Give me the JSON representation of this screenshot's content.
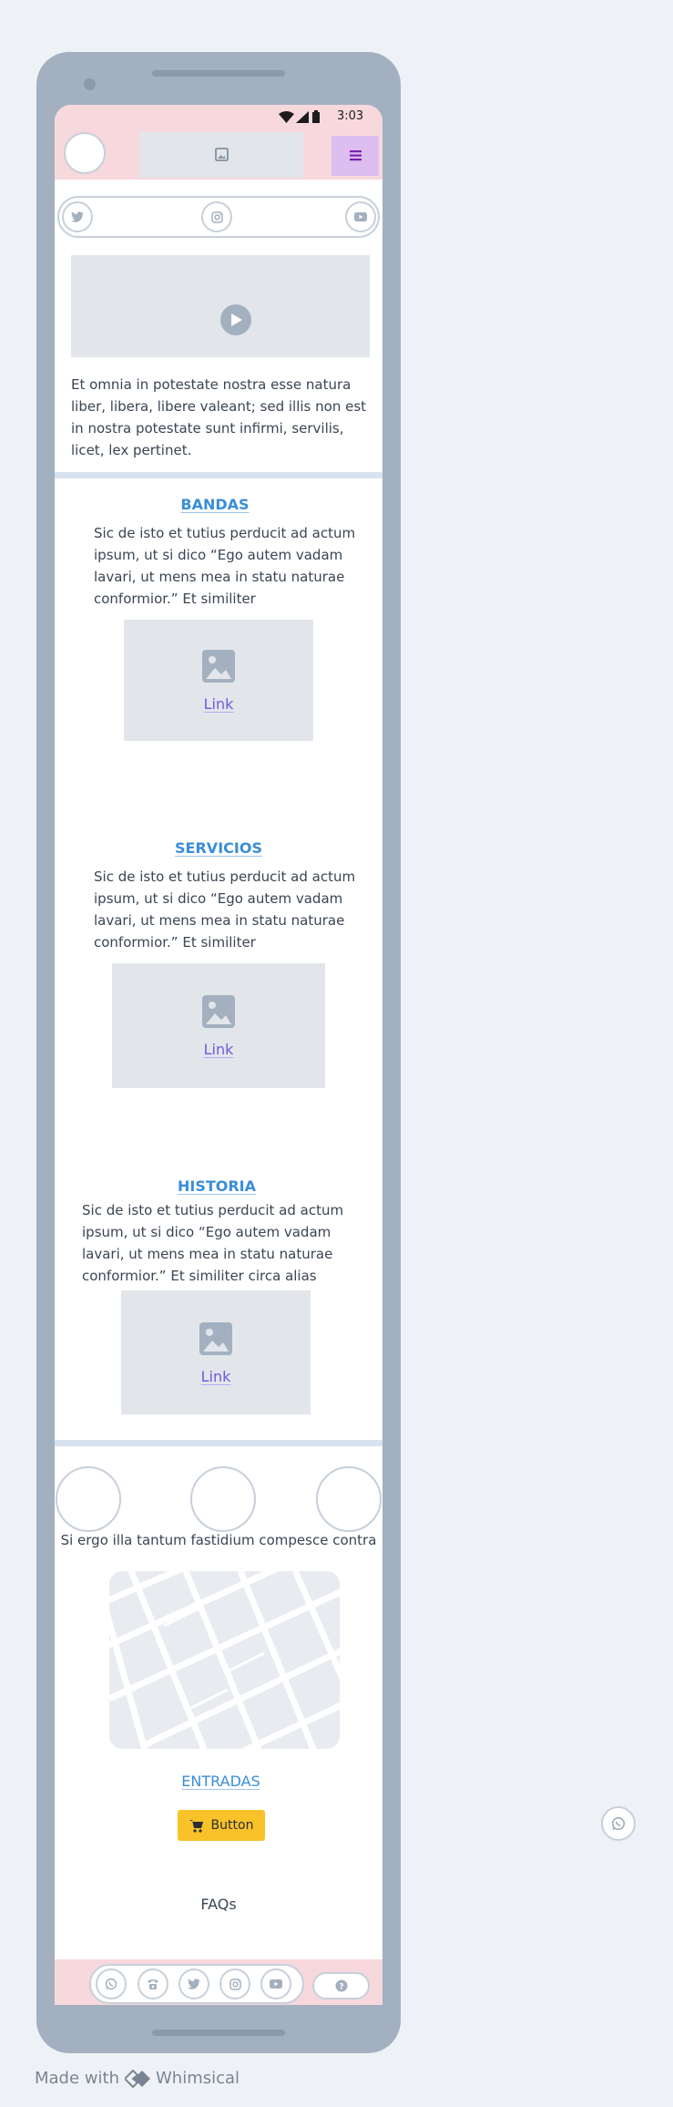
{
  "status_bar": {
    "time": "3:03"
  },
  "intro": {
    "text": "Et omnia in potestate nostra esse natura liber, libera, libere valeant; sed illis non est in nostra potestate sunt infirmi, servilis, licet, lex pertinet."
  },
  "sections": [
    {
      "title": "BANDAS",
      "text": "Sic de isto et tutius perducit ad actum ipsum, ut si dico “Ego autem vadam lavari, ut mens mea in statu naturae conformior.” Et similiter",
      "link": "Link"
    },
    {
      "title": "SERVICIOS",
      "text": "Sic de isto et tutius perducit ad actum ipsum, ut si dico “Ego autem vadam lavari, ut mens mea in statu naturae conformior.” Et similiter",
      "link": "Link"
    },
    {
      "title": "HISTORIA",
      "text": "Sic de isto et tutius perducit ad actum ipsum, ut si dico “Ego autem vadam lavari, ut mens mea in statu naturae conformior.” Et similiter circa alias",
      "link": "Link"
    }
  ],
  "partners": {
    "caption": "Si ergo illa tantum fastidium compesce contra"
  },
  "tickets": {
    "title": "ENTRADAS",
    "button_label": "Button"
  },
  "faqs": {
    "label": "FAQs"
  },
  "made_with": {
    "prefix": "Made with",
    "brand": "Whimsical"
  },
  "colors": {
    "header_bg": "#f7d8dd",
    "menu_bg": "#dcbef0",
    "accent_link": "#3a8ed8",
    "link": "#6f5ae0",
    "button": "#f9c228"
  },
  "icons": [
    "wifi-icon",
    "signal-icon",
    "battery-icon",
    "image-icon",
    "hamburger-icon",
    "twitter-icon",
    "instagram-icon",
    "youtube-icon",
    "play-icon",
    "cart-icon",
    "whatsapp-icon",
    "phone-icon",
    "help-icon"
  ]
}
